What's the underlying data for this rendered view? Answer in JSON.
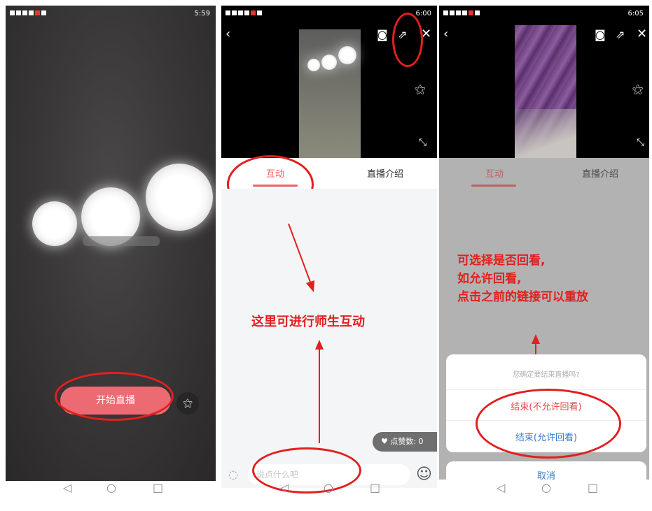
{
  "status": {
    "left": "▣ᴴ.ıl ☰ ⊠",
    "phone1_time": "5:59",
    "phone2_time": "6:00",
    "phone3_time": "6:05"
  },
  "phone1": {
    "start_button": "开始直播"
  },
  "phone2": {
    "tabs": [
      "互动",
      "直播介绍"
    ],
    "likes": "点赞数: 0",
    "input_placeholder": "说点什么吧",
    "annotation": "这里可进行师生互动"
  },
  "phone3": {
    "tabs": [
      "互动",
      "直播介绍"
    ],
    "annotation": [
      "可选择是否回看,",
      "如允许回看,",
      "点击之前的链接可以重放"
    ],
    "dialog_prompt": "您确定要结束直播吗?",
    "option_no_replay": "结束(不允许回看)",
    "option_replay": "结束(允许回看)",
    "cancel": "取消"
  },
  "colors": {
    "accent": "#f25d5d",
    "annotation": "#e21f1f",
    "link": "#3a79c9"
  }
}
